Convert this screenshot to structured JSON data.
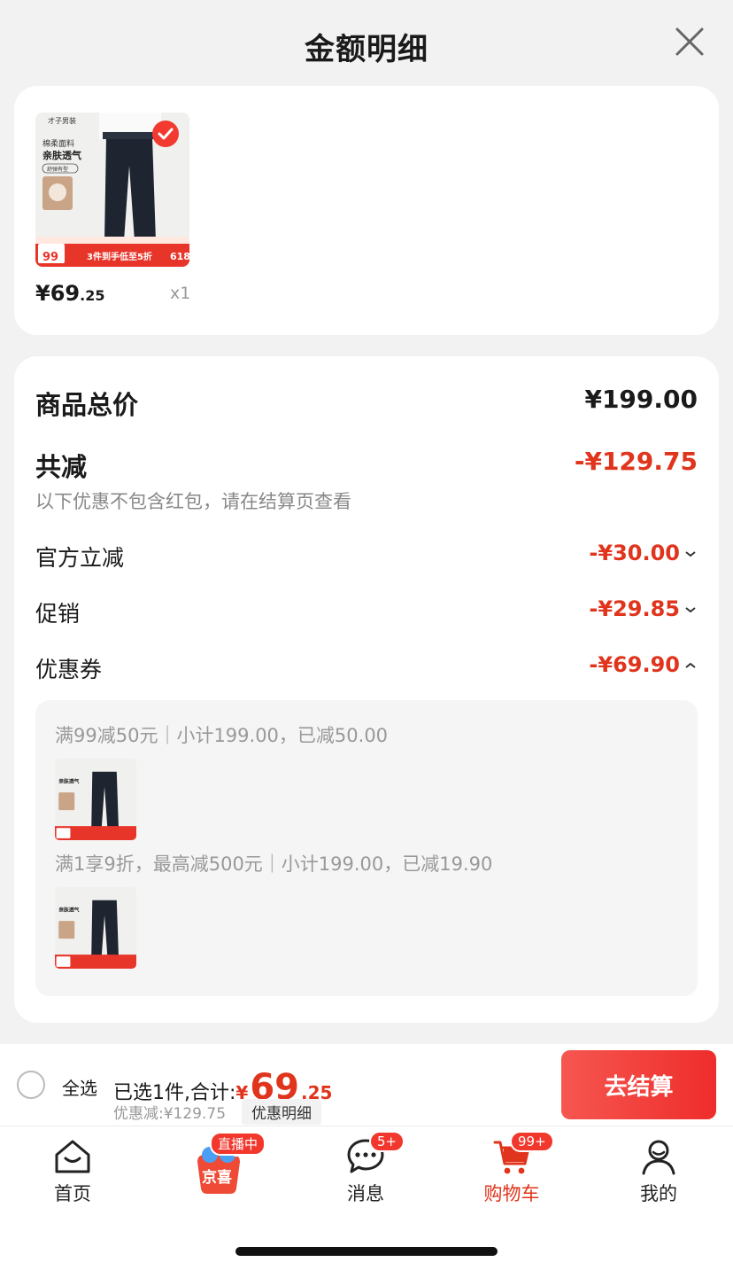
{
  "header": {
    "title": "金额明细"
  },
  "product": {
    "price_int": "¥69",
    "price_dec": ".25",
    "quantity": "x1",
    "image_texts": {
      "brand": "才子男装",
      "line1": "棉柔面料",
      "line2": "亲肤透气",
      "tag": "舒弹有型",
      "promo_price": "99",
      "promo": "3件到手低至5折",
      "event": "618"
    }
  },
  "summary": {
    "total_label": "商品总价",
    "total_value": "¥199.00",
    "discount_label": "共减",
    "discount_value": "-¥129.75",
    "note": "以下优惠不包含红包，请在结算页查看",
    "items": [
      {
        "label": "官方立减",
        "value": "-¥30.00",
        "expanded": false
      },
      {
        "label": "促销",
        "value": "-¥29.85",
        "expanded": false
      },
      {
        "label": "优惠券",
        "value": "-¥69.90",
        "expanded": true
      }
    ],
    "coupons": [
      {
        "text": "满99减50元｜小计199.00，已减50.00"
      },
      {
        "text": "满1享9折，最高减500元｜小计199.00，已减19.90"
      }
    ]
  },
  "bottom": {
    "select_all": "全选",
    "selected_text": "已选1件,合计:",
    "total_symbol": "¥",
    "total_int": "69",
    "total_dec": ".25",
    "discount_text": "优惠减:¥129.75",
    "detail_button": "优惠明细",
    "checkout_button": "去结算"
  },
  "tabbar": {
    "items": [
      {
        "label": "首页",
        "icon": "home-icon"
      },
      {
        "label": "京喜",
        "icon": "jingxi-icon",
        "badge": "直播中"
      },
      {
        "label": "消息",
        "icon": "message-icon",
        "badge": "5+"
      },
      {
        "label": "购物车",
        "icon": "cart-icon",
        "badge": "99+",
        "active": true
      },
      {
        "label": "我的",
        "icon": "profile-icon"
      }
    ]
  },
  "colors": {
    "accent": "#e0341c",
    "checkout": "#ee2d2b",
    "active_tab": "#e0341c"
  }
}
